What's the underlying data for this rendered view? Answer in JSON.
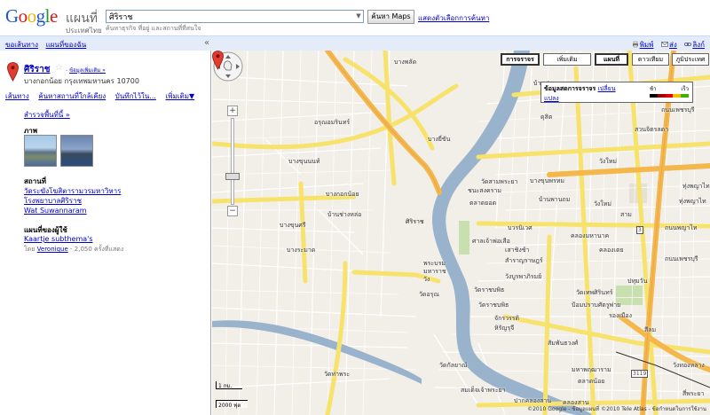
{
  "header": {
    "logo_google": "Google",
    "logo_maps": "แผนที่",
    "logo_region": "ประเทศไทย",
    "search_value": "ศิริราช",
    "search_hint": "ค้นหาธุรกิจ ที่อยู่ และสถานที่ที่สนใจ",
    "search_button": "ค้นหา Maps",
    "search_options": "แสดงตัวเลือกการค้นหา"
  },
  "toolbar": {
    "directions": "ขอเส้นทาง",
    "my_maps": "แผนที่ของฉัน",
    "collapse": "«",
    "print": "พิมพ์",
    "send": "ส่ง",
    "link": "ลิงก์"
  },
  "result": {
    "title": "ศิริราช",
    "more_info": "ข้อมูลเพิ่มเติม »",
    "address": "บางกอกน้อย กรุงเทพมหานคร 10700",
    "actions": [
      "เส้นทาง",
      "ค้นหาสถานที่ใกล้เคียง",
      "บันทึกไว้ใน...",
      "เพิ่มเติม▼"
    ],
    "nearby": "สำรวจพื้นที่นี้ »",
    "photos_heading": "ภาพ",
    "places_heading": "สถานที่",
    "places": [
      "วัดระฆังโฆสิตารามวรมหาวิหาร",
      "โรงพยาบาลศิริราช",
      "Wat Suwannaram"
    ],
    "user_maps_heading": "แผนที่ของผู้ใช้",
    "user_map_title": "Kaartje subthema's",
    "user_map_by": "โดย",
    "user_map_author": "Veronique",
    "user_map_views": " - 2,050 ครั้งที่แสดง"
  },
  "map": {
    "types": [
      "การจราจร",
      "เพิ่มเติม",
      "แผนที่",
      "ดาวเทียม",
      "ภูมิประเทศ"
    ],
    "active_type": "แผนที่",
    "traffic_title": "ข้อมูลสดการจราจร",
    "traffic_change": "เปลี่ยน",
    "traffic_edit": "แปลง",
    "traffic_slow": "ช้า",
    "traffic_fast": "เร็ว",
    "traffic_colors": [
      "#000000",
      "#a00000",
      "#e00000",
      "#f0c000",
      "#40b000"
    ],
    "pin_label": "ศิริราช",
    "labels": [
      "บางพลัด",
      "บ้านปูน",
      "บางยี่ขัน",
      "อรุณอมรินทร์",
      "บางขุนนนท์",
      "บางกอกน้อย",
      "บ้านช่างหล่อ",
      "บางขุนศรี",
      "บางระมาด",
      "พระบรมมหาราชวัง",
      "วัดอรุณ",
      "วัดราชบพิธ",
      "เสาชิงช้า",
      "สำราญราษฎร์",
      "บ้านพานถม",
      "บวรนิเวศ",
      "ชนะสงคราม",
      "วัดสามพระยา",
      "ตลาดยอด",
      "คลองมหานาค",
      "วังใหม่",
      "ถนนพญาไท",
      "ถนนเพชรบุรี",
      "ปทุมวัน",
      "วัดเทพศิรินทร์",
      "ป้อมปราบศัตรูพ่าย",
      "สัมพันธวงศ์",
      "จักรวรรดิ",
      "วัดกัลยาณ์",
      "วัดท่าพระ",
      "หิรัญรุจี",
      "ปากคลองสาน",
      "ถนนเพชรบุรี",
      "สวนจิตรลดา",
      "ทุ่งพญาไท",
      "วังทองหลาง",
      "สี่พระยา",
      "วังใหม่",
      "สาม",
      "ทุ่งพญาไท",
      "ดุสิต",
      "คลองเตย",
      "รองเมือง",
      "มหาพฤฒาราม",
      "ตลาดน้อย",
      "บางขุนพรหม",
      "ศาลเจ้าพ่อเสือ",
      "วัดราชบพิธ",
      "สีลม",
      "วังบูรพาภิรมย์",
      "คลองสาน",
      "สมเด็จเจ้าพระยา"
    ],
    "scale_km": "1 กม.",
    "scale_m": "2000 ฟุต",
    "copyright": "©2010 Google - ข้อมูลแผนที่ ©2010 Tele Atlas - ข้อกำหนดในการใช้งาน"
  }
}
